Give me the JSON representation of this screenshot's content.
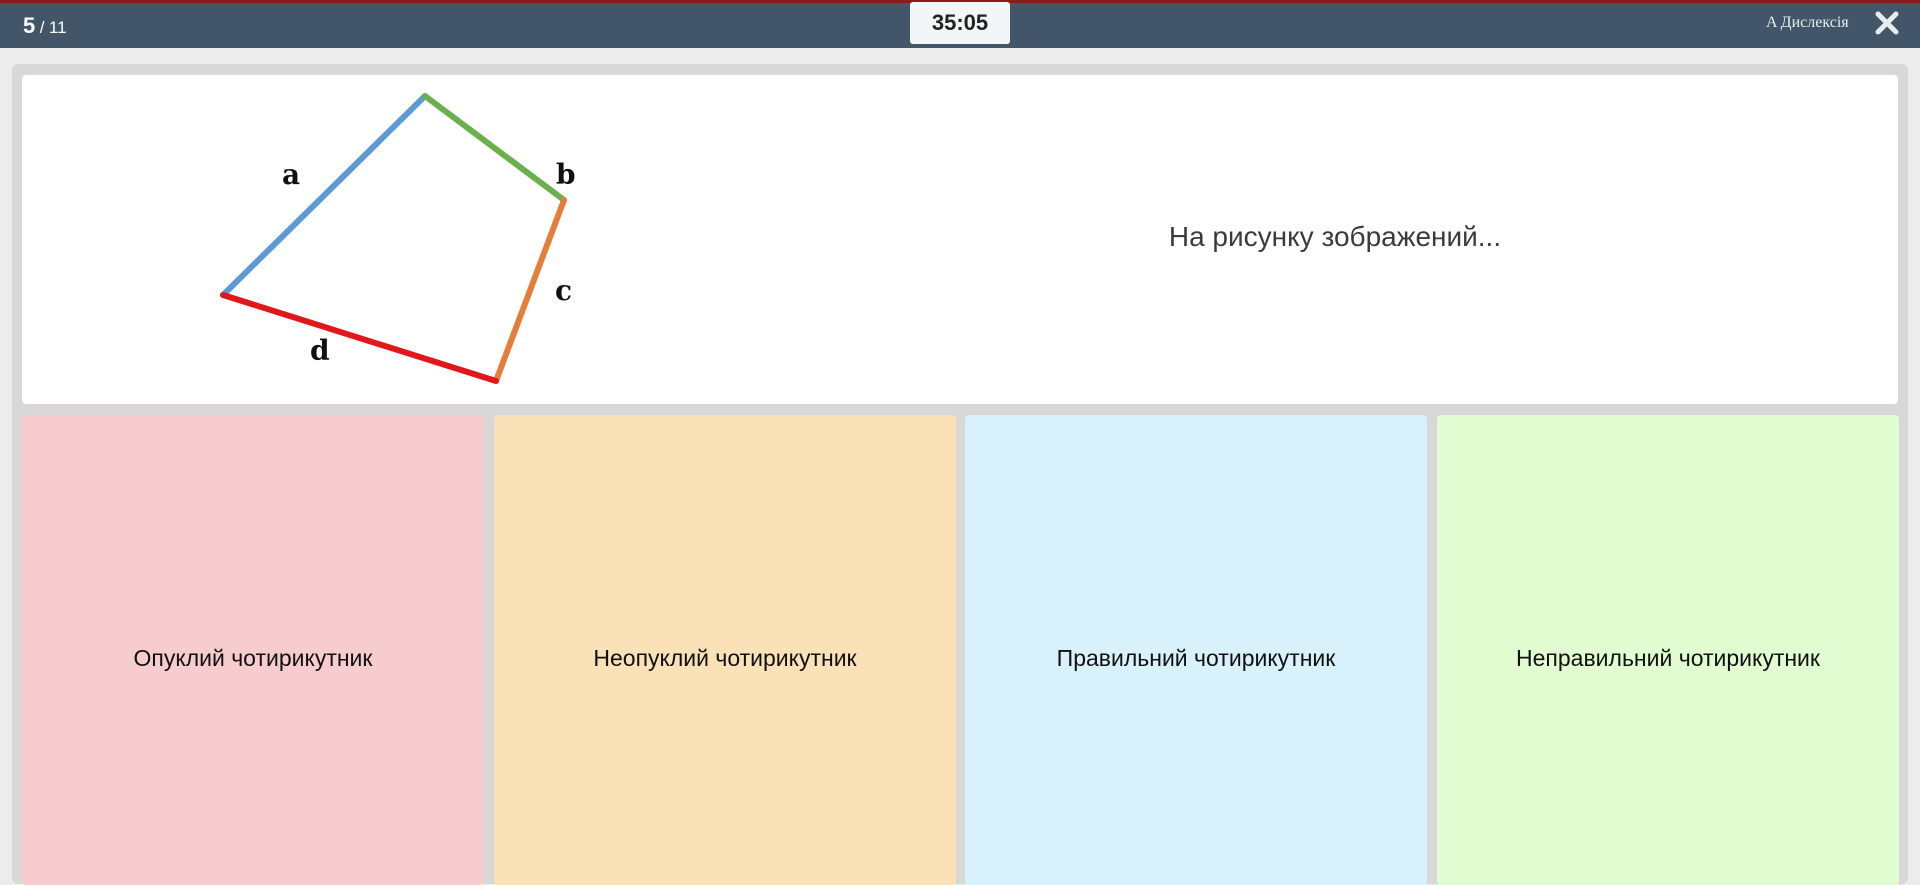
{
  "header": {
    "progress_current": "5",
    "progress_separator": "/",
    "progress_total": "11",
    "timer": "35:05",
    "dyslexia_label": "A Дислексія",
    "close_icon": "close-icon"
  },
  "question": {
    "text": "На рисунку зображений...",
    "figure": {
      "side_labels": [
        "a",
        "b",
        "c",
        "d"
      ],
      "side_colors": {
        "a": "#5b9bd5",
        "b": "#6ab04c",
        "c": "#e67e3a",
        "d": "#e0181b"
      }
    }
  },
  "answers": [
    {
      "label": "Опуклий чотирикутник",
      "color": "#f6cccf"
    },
    {
      "label": "Неопуклий чотирикутник",
      "color": "#fae1b8"
    },
    {
      "label": "Правильний чотирикутник",
      "color": "#d9f1fb"
    },
    {
      "label": "Неправильний чотирикутник",
      "color": "#e1fcd0"
    }
  ]
}
